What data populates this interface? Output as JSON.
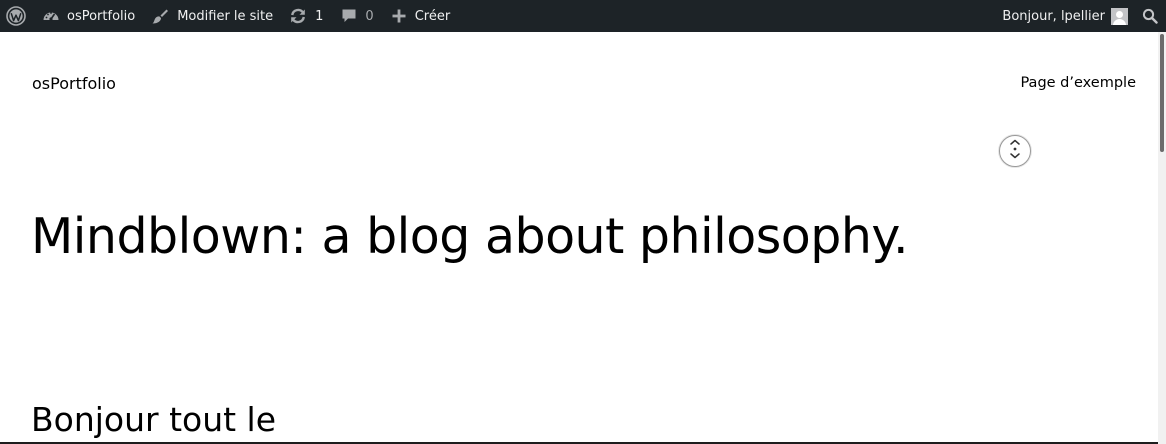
{
  "adminbar": {
    "wp_logo": "wordpress-icon",
    "site_name": "osPortfolio",
    "edit_label": "Modifier le site",
    "updates_count": "1",
    "comments_count": "0",
    "new_label": "Créer",
    "greeting": "Bonjour, lpellier"
  },
  "header": {
    "site_title": "osPortfolio",
    "nav_link": "Page d’exemple"
  },
  "main": {
    "hero_heading": "Mindblown: a blog about philosophy.",
    "post_title": "Bonjour tout le"
  },
  "colors": {
    "adminbar_bg": "#1d2327",
    "adminbar_text": "#f0f0f1",
    "page_bg": "#ffffff",
    "text": "#000000"
  }
}
